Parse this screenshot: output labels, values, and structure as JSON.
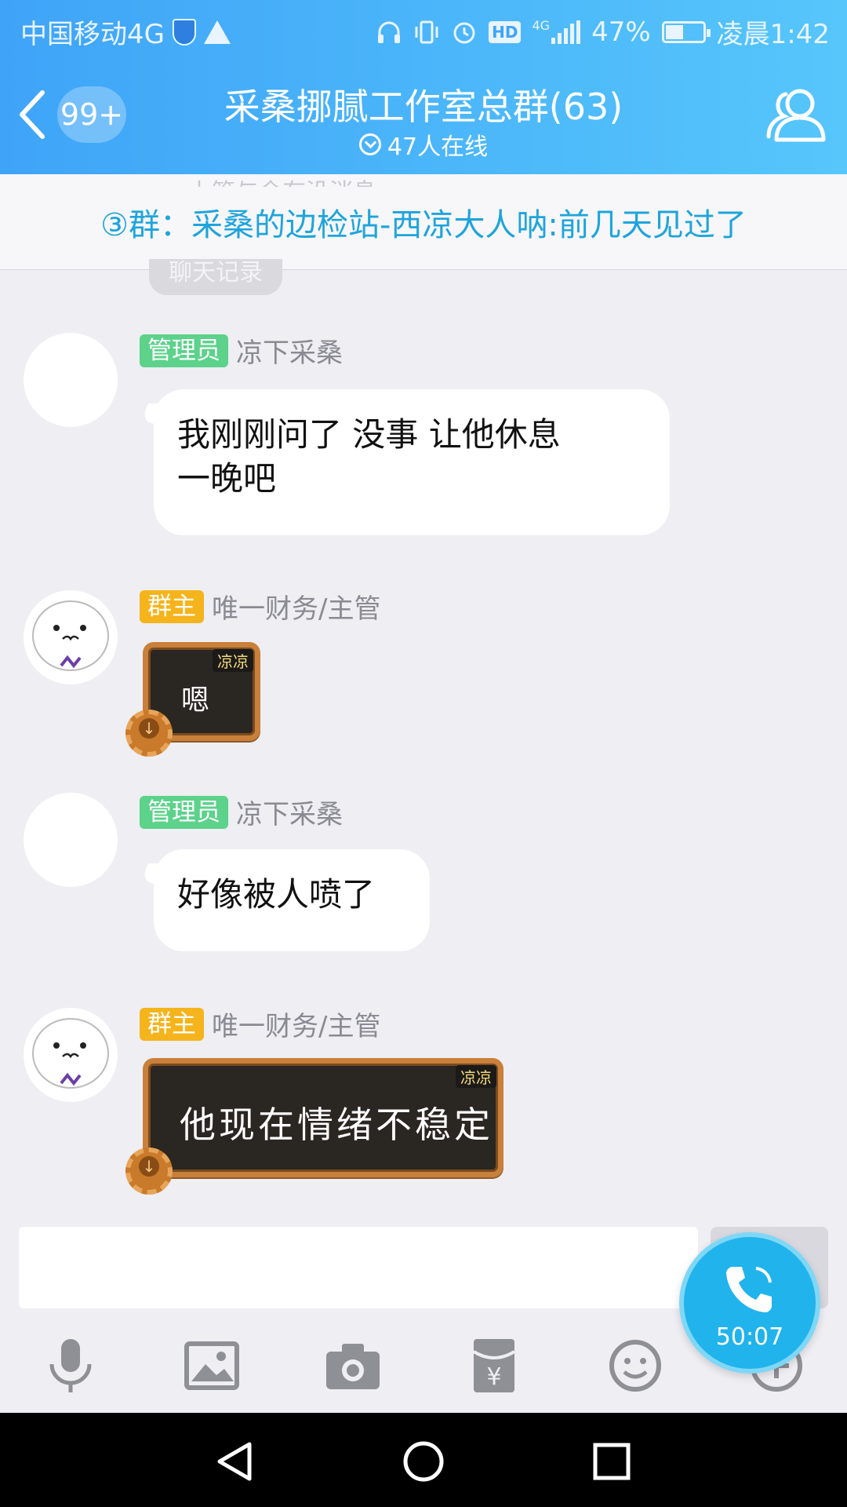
{
  "status_bar": {
    "carrier": "中国移动4G",
    "network": "4G",
    "battery": "47%",
    "time": "凌晨1:42"
  },
  "header": {
    "unread_badge": "99+",
    "title": "采桑挪腻工作室总群(63)",
    "online": "47人在线"
  },
  "notice": {
    "ghost_text": "上管与余有没消息",
    "text": "③群：采桑的边检站-西凉大人呐:前几天见过了"
  },
  "history_pill": "聊天记录",
  "messages": [
    {
      "role_tag": "管理员",
      "sender": "凉下采桑",
      "type": "text",
      "text": "我刚刚问了 没事 让他休息\n一晚吧"
    },
    {
      "role_tag": "群主",
      "sender": "唯一财务/主管",
      "type": "sticker",
      "sticker_label": "凉凉",
      "text": "嗯"
    },
    {
      "role_tag": "管理员",
      "sender": "凉下采桑",
      "type": "text",
      "text": "好像被人喷了"
    },
    {
      "role_tag": "群主",
      "sender": "唯一财务/主管",
      "type": "sticker",
      "sticker_label": "凉凉",
      "text": "他现在情绪不稳定"
    }
  ],
  "call": {
    "duration": "50:07"
  },
  "toolbar_icons": [
    "mic-icon",
    "image-icon",
    "camera-icon",
    "red-packet-icon",
    "emoji-icon",
    "plus-icon"
  ],
  "colors": {
    "header_start": "#3fa4f8",
    "header_end": "#56c6fb",
    "admin_tag": "#5cd28a",
    "owner_tag": "#f5b41c",
    "notice_text": "#1fa4dc",
    "call_fab": "#21b3ec"
  }
}
